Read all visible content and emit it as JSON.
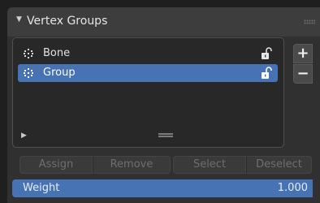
{
  "panel": {
    "title": "Vertex Groups",
    "collapse_icon": "triangle-down-icon",
    "drag_icon": "grip-dots-icon"
  },
  "vertex_groups": {
    "items": [
      {
        "label": "Bone",
        "icon": "vertex-group-icon",
        "lock_icon": "unlocked-padlock-icon",
        "selected": false
      },
      {
        "label": "Group",
        "icon": "vertex-group-icon",
        "lock_icon": "unlocked-padlock-icon",
        "selected": true
      }
    ],
    "expand_icon": "triangle-right-icon",
    "resize_icon": "resize-grip-icon",
    "add_label": "+",
    "remove_label": "−"
  },
  "actions": {
    "assign": "Assign",
    "remove": "Remove",
    "select": "Select",
    "deselect": "Deselect"
  },
  "weight": {
    "label": "Weight",
    "value": "1.000"
  },
  "colors": {
    "accent": "#4772b3",
    "panel_bg": "#303030",
    "header_bg": "#3d3d3d"
  }
}
